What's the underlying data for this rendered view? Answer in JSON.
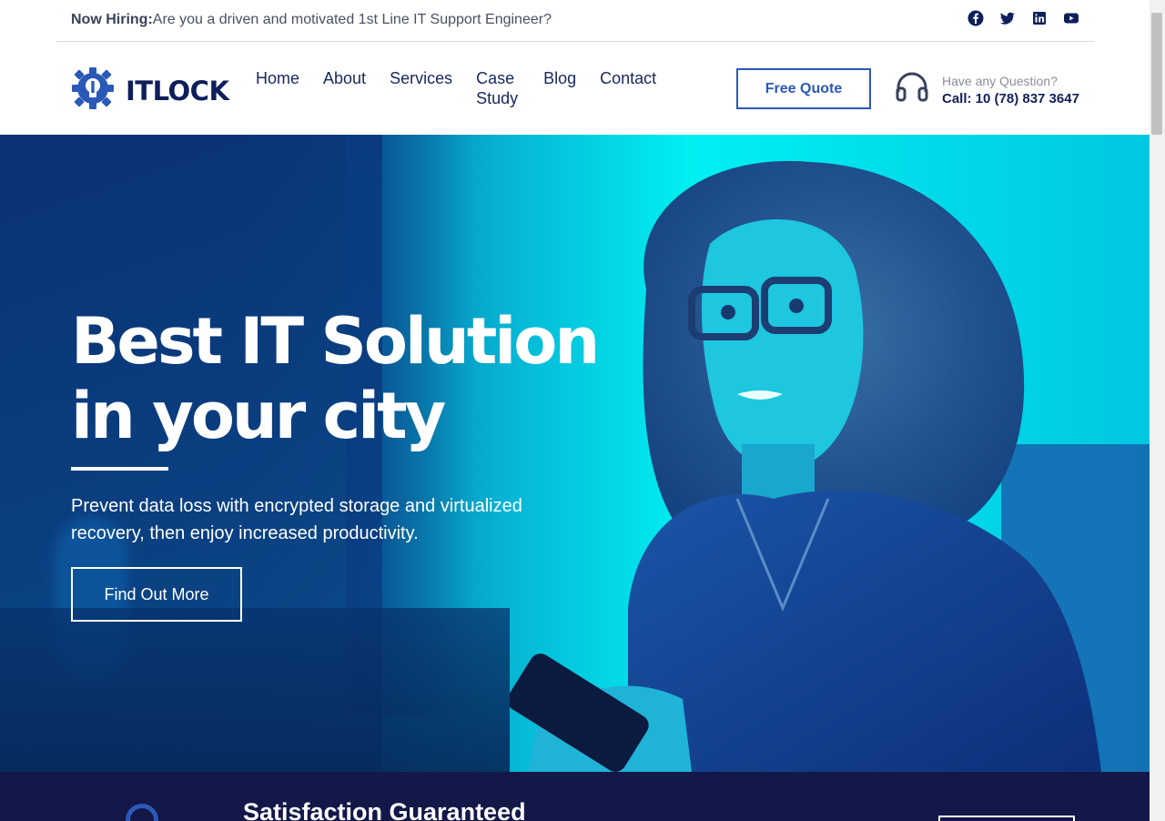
{
  "topbar": {
    "hiring_label": "Now Hiring:",
    "hiring_text": "Are you a driven and motivated 1st Line IT Support Engineer?",
    "socials": [
      "facebook-icon",
      "twitter-icon",
      "linkedin-icon",
      "youtube-icon"
    ]
  },
  "header": {
    "logo_text": "ITLOCK",
    "nav": [
      "Home",
      "About",
      "Services",
      "Case Study",
      "Blog",
      "Contact"
    ],
    "free_quote": "Free Quote",
    "question": "Have any Question?",
    "call": "Call: 10 (78) 837 3647"
  },
  "hero": {
    "title_line1": "Best IT Solution",
    "title_line2": "in your city",
    "subtitle": "Prevent data loss with encrypted storage and virtualized recovery, then enjoy increased productivity.",
    "button": "Find Out More"
  },
  "band": {
    "title": "Satisfaction Guaranteed"
  },
  "colors": {
    "brand": "#2b59b8",
    "navy": "#0e1f5b",
    "band": "#131849",
    "hero_cyan": "#00f0f2"
  }
}
